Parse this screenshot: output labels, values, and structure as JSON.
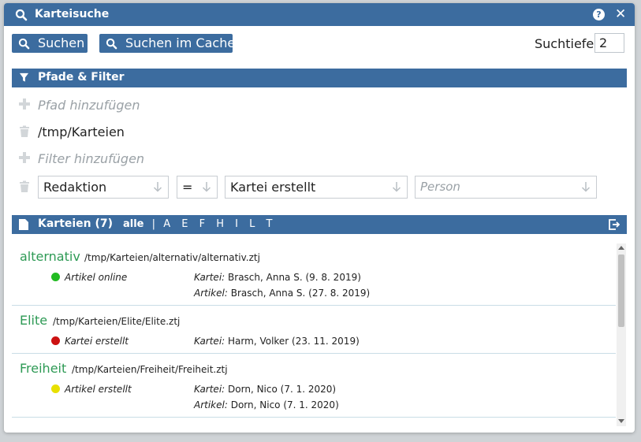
{
  "window": {
    "title": "Karteisuche"
  },
  "toolbar": {
    "search_label": "Suchen",
    "search_cache_label": "Suchen im Cache",
    "depth_label": "Suchtiefe",
    "depth_value": "2"
  },
  "paths_filter": {
    "title": "Pfade & Filter",
    "add_path": "Pfad hinzufügen",
    "path": "/tmp/Karteien",
    "add_filter": "Filter hinzufügen",
    "filter": {
      "field": "Redaktion",
      "operator": "=",
      "value": "Kartei erstellt",
      "person_placeholder": "Person"
    }
  },
  "results": {
    "title": "Karteien (7)",
    "filter_all": "alle",
    "separator": "|",
    "letters": [
      "A",
      "E",
      "F",
      "H",
      "I",
      "L",
      "T"
    ]
  },
  "entries": [
    {
      "name": "alternativ",
      "path": "/tmp/Karteien/alternativ/alternativ.ztj",
      "status": "Artikel online",
      "status_color": "#22bb22",
      "meta": [
        {
          "label": "Kartei:",
          "value": "Brasch, Anna S. (9. 8. 2019)"
        },
        {
          "label": "Artikel:",
          "value": "Brasch, Anna S. (27. 8. 2019)"
        }
      ]
    },
    {
      "name": "Elite",
      "path": "/tmp/Karteien/Elite/Elite.ztj",
      "status": "Kartei erstellt",
      "status_color": "#cc1111",
      "meta": [
        {
          "label": "Kartei:",
          "value": "Harm, Volker (23. 11. 2019)"
        }
      ]
    },
    {
      "name": "Freiheit",
      "path": "/tmp/Karteien/Freiheit/Freiheit.ztj",
      "status": "Artikel erstellt",
      "status_color": "#e8e000",
      "meta": [
        {
          "label": "Kartei:",
          "value": "Dorn, Nico (7. 1. 2020)"
        },
        {
          "label": "Artikel:",
          "value": "Dorn, Nico (7. 1. 2020)"
        }
      ]
    }
  ],
  "colors": {
    "accent": "#3c6c9f",
    "link_green": "#2e9a55"
  }
}
